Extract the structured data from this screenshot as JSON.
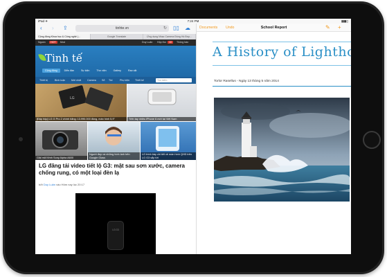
{
  "status_bar": {
    "left": "iPad ✈",
    "time": "7:24 PM",
    "right": ""
  },
  "safari": {
    "url": "tinhte.vn",
    "tabs": [
      "Cộng đồng Khoa học & Công nghệ |...",
      "Google Translate",
      "Ứng dụng Nhạc Camera Đồng Hồ Đẹp..."
    ]
  },
  "site": {
    "topbar": {
      "left1": "Nguồn",
      "hot": "HOT",
      "left2": "Mod",
      "user": "Duy Luân",
      "inbox": "Hộp thư",
      "inbox_count": "10",
      "notify": "Thông báo"
    },
    "logo": "Tinh tế",
    "nav": [
      "Cộng đồng",
      "Diễn đàn",
      "Sự kiện",
      "Thư viện",
      "Gallery",
      "Rao vặt"
    ],
    "subnav": [
      "Thiết bị",
      "Bình luận",
      "Mới nhất",
      "Camera",
      "Sổ",
      "Tivi",
      "Phụ kiện",
      "Thiết kế"
    ],
    "search_placeholder": "Tìm kiếm",
    "thumbs": [
      "[Đập hộp] LG G Pro 2 chính hãng: 13.990.000 đồng, màn hình 5,9\"",
      "Trên tay nhiều iPhone 6 mới tại Việt Nam",
      "Giải mã Kênh Sony Alpha A600",
      "Người đẹp và những hình ảnh trên Google Glass",
      "LG trình bày chi tiết về màn hình QHD trên LG G3 sắp tới"
    ],
    "headline": "LG đăng tải video tiết lộ G3: mặt sau sơn xước, camera chống rung, có một loại đèn lạ",
    "byline_prefix": "bởi",
    "byline_author": "Duy Luân",
    "byline_suffix": "vào Hôm nay lúc 20:17",
    "watch_text": "LG G3"
  },
  "pages": {
    "documents": "Documents",
    "undo": "Undo",
    "title": "School Report",
    "doc_title": "A History of Lighthouses",
    "author_line": "Torlor Rasellus - Ngày 13 tháng 5 năm 2014"
  }
}
